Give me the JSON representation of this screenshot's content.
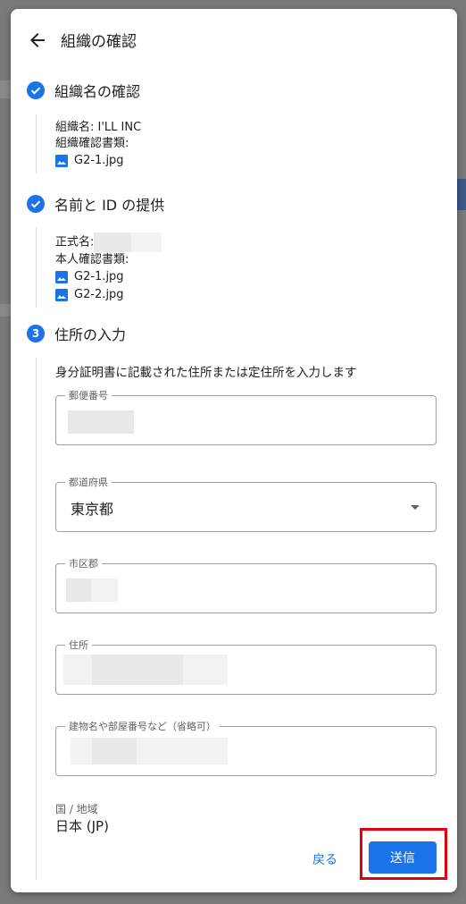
{
  "dialog": {
    "title": "組織の確認",
    "steps": [
      {
        "number": "",
        "label": "組織名の確認",
        "details": {
          "org_name": "組織名: I'LL INC",
          "doc_label": "組織確認書類:",
          "files": [
            "G2-1.jpg"
          ]
        }
      },
      {
        "number": "",
        "label": "名前と ID の提供",
        "details": {
          "legal_name_label": "正式名:",
          "doc_label": "本人確認書類:",
          "files": [
            "G2-1.jpg",
            "G2-2.jpg"
          ]
        }
      },
      {
        "number": "3",
        "label": "住所の入力"
      }
    ],
    "address": {
      "hint": "身分証明書に記載された住所または定住所を入力します",
      "postal_label": "郵便番号",
      "prefecture_label": "都道府県",
      "prefecture_value": "東京都",
      "city_label": "市区郡",
      "street_label": "住所",
      "building_label": "建物名や部屋番号など（省略可）",
      "country_label": "国 / 地域",
      "country_value": "日本 (JP)"
    },
    "actions": {
      "back_label": "戻る",
      "send_label": "送信"
    }
  },
  "colors": {
    "accent": "#1a73e8",
    "highlight": "#e0000e"
  },
  "icons": {
    "back": "arrow-left-icon",
    "check": "check-circle-icon",
    "image": "image-file-icon",
    "dropdown": "dropdown-arrow-icon"
  }
}
